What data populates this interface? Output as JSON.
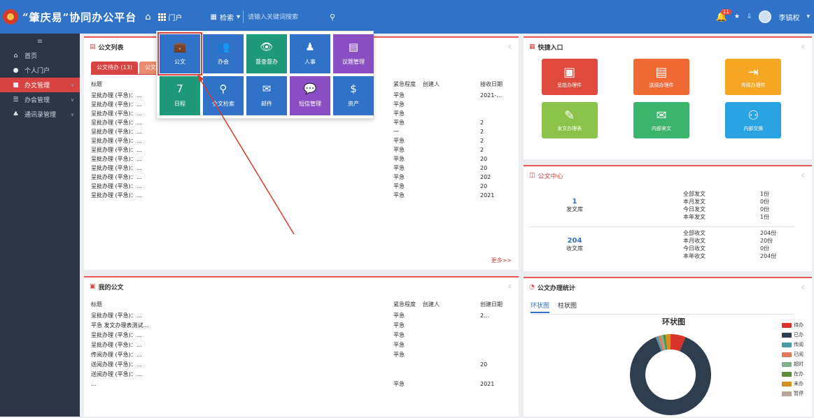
{
  "header": {
    "app_title": "“肇庆易”协同办公平台",
    "portal_label": "门户",
    "search_label": "检索",
    "search_placeholder": "请输入关键词搜索",
    "notification_count": "11",
    "user_name": "李镐权"
  },
  "sidebar": {
    "items": [
      {
        "label": "首页",
        "icon": "home-icon"
      },
      {
        "label": "个人门户",
        "icon": "user-icon"
      },
      {
        "label": "办文管理",
        "icon": "briefcase-icon",
        "active": true
      },
      {
        "label": "办会管理",
        "icon": "meeting-icon"
      },
      {
        "label": "通讯录管理",
        "icon": "org-icon"
      }
    ]
  },
  "dropdown": {
    "tiles": [
      {
        "label": "公文",
        "color": "#2f72c8",
        "glyph": "💼",
        "selected": true
      },
      {
        "label": "办会",
        "color": "#2f72c8",
        "glyph": "👥"
      },
      {
        "label": "督查督办",
        "color": "#1e9a7a",
        "glyph": "👁"
      },
      {
        "label": "人事",
        "color": "#2f72c8",
        "glyph": "♟"
      },
      {
        "label": "议题管理",
        "color": "#8b4ec2",
        "glyph": "▤"
      },
      {
        "label": "日程",
        "color": "#1e9a7a",
        "glyph": "7"
      },
      {
        "label": "全文检索",
        "color": "#2f72c8",
        "glyph": "⚲"
      },
      {
        "label": "邮件",
        "color": "#2f72c8",
        "glyph": "✉"
      },
      {
        "label": "短信管理",
        "color": "#8b4ec2",
        "glyph": "💬"
      },
      {
        "label": "资产",
        "color": "#2f72c8",
        "glyph": "$"
      }
    ]
  },
  "doc_list": {
    "title": "公文列表",
    "tab_active": "公文待办 (13)",
    "tab_other": "公文已",
    "headers": {
      "title": "标题",
      "priority": "紧急程度",
      "user": "创建人",
      "date": "接收日期"
    },
    "rows": [
      {
        "title": "呈批办理 (平急)：…",
        "priority": "平急",
        "date": "2021-…"
      },
      {
        "title": "呈批办理 (平急)：…",
        "priority": "平急",
        "date": ""
      },
      {
        "title": "呈批办理 (平急)：…",
        "priority": "平急",
        "date": ""
      },
      {
        "title": "呈批办理 (平急)：…",
        "priority": "平急",
        "date": "2"
      },
      {
        "title": "呈批办理 (平急)：…",
        "priority": "一",
        "date": "2"
      },
      {
        "title": "呈批办理 (平急)：…",
        "priority": "平急",
        "date": "2"
      },
      {
        "title": "呈批办理 (平急)：…",
        "priority": "平急",
        "date": "2"
      },
      {
        "title": "呈批办理 (平急)：…",
        "priority": "平急",
        "date": "20"
      },
      {
        "title": "呈批办理 (平急)：…",
        "priority": "平急",
        "date": "20"
      },
      {
        "title": "呈批办理 (平急)：…",
        "priority": "平急",
        "date": "202"
      },
      {
        "title": "呈批办理 (平急)：…",
        "priority": "平急",
        "date": "20"
      },
      {
        "title": "呈批办理 (平急)：…",
        "priority": "平急",
        "date": "2021"
      }
    ],
    "more": "更多>>"
  },
  "my_docs": {
    "title": "我的公文",
    "headers": {
      "title": "标题",
      "priority": "紧急程度",
      "user": "创建人",
      "date": "创建日期"
    },
    "rows": [
      {
        "title": "呈批办理 (平急)：…",
        "priority": "平急",
        "date": "2…"
      },
      {
        "title": "平急 发文办理表测试…",
        "priority": "平急",
        "date": ""
      },
      {
        "title": "呈批办理 (平急)：…",
        "priority": "平急",
        "date": ""
      },
      {
        "title": "呈批办理 (平急)：…",
        "priority": "平急",
        "date": ""
      },
      {
        "title": "传阅办理 (平急)：…",
        "priority": "平急",
        "date": ""
      },
      {
        "title": "送阅办理 (平急)：…",
        "priority": "",
        "date": "20"
      },
      {
        "title": "送阅办理 (平急)：…",
        "priority": "",
        "date": ""
      },
      {
        "title": "…",
        "priority": "平急",
        "date": "2021"
      }
    ]
  },
  "quick_entry": {
    "title": "快捷入口",
    "items": [
      {
        "label": "呈批办理件",
        "color": "#e04a3c",
        "glyph": "▣"
      },
      {
        "label": "送阅办理件",
        "color": "#f06a34",
        "glyph": "▤"
      },
      {
        "label": "传阅办理件",
        "color": "#f5a623",
        "glyph": "⇥"
      },
      {
        "label": "发文办理表",
        "color": "#8bc34a",
        "glyph": "✎"
      },
      {
        "label": "内部来文",
        "color": "#3bb56b",
        "glyph": "✉"
      },
      {
        "label": "内部交换",
        "color": "#29a3e3",
        "glyph": "⚇"
      }
    ]
  },
  "doc_center": {
    "title": "公文中心",
    "blocks": [
      {
        "num": "1",
        "cap": "发文库",
        "lines": [
          {
            "label": "全部发文",
            "value": "1份"
          },
          {
            "label": "本月发文",
            "value": "0份"
          },
          {
            "label": "今日发文",
            "value": "0份"
          },
          {
            "label": "本年发文",
            "value": "1份"
          }
        ]
      },
      {
        "num": "204",
        "cap": "收文库",
        "lines": [
          {
            "label": "全部收文",
            "value": "204份"
          },
          {
            "label": "本月收文",
            "value": "20份"
          },
          {
            "label": "今日收文",
            "value": "0份"
          },
          {
            "label": "本年收文",
            "value": "204份"
          }
        ]
      }
    ]
  },
  "stats": {
    "title": "公文办理统计",
    "tab_active": "环状图",
    "tab_other": "柱状图",
    "chart_title": "环状图"
  },
  "chart_data": {
    "type": "pie",
    "title": "环状图",
    "series": [
      {
        "name": "",
        "values": [
          6,
          88,
          1,
          1,
          1,
          1,
          2,
          0
        ]
      }
    ],
    "categories": [
      "待办",
      "已办",
      "传阅",
      "已阅",
      "超时",
      "在办",
      "未办",
      "暂停"
    ],
    "colors": [
      "#d9342b",
      "#2f3e4e",
      "#4a9aa8",
      "#e07a5f",
      "#82b08c",
      "#5e8a3e",
      "#d4901c",
      "#b7a59c"
    ],
    "donut": true
  }
}
